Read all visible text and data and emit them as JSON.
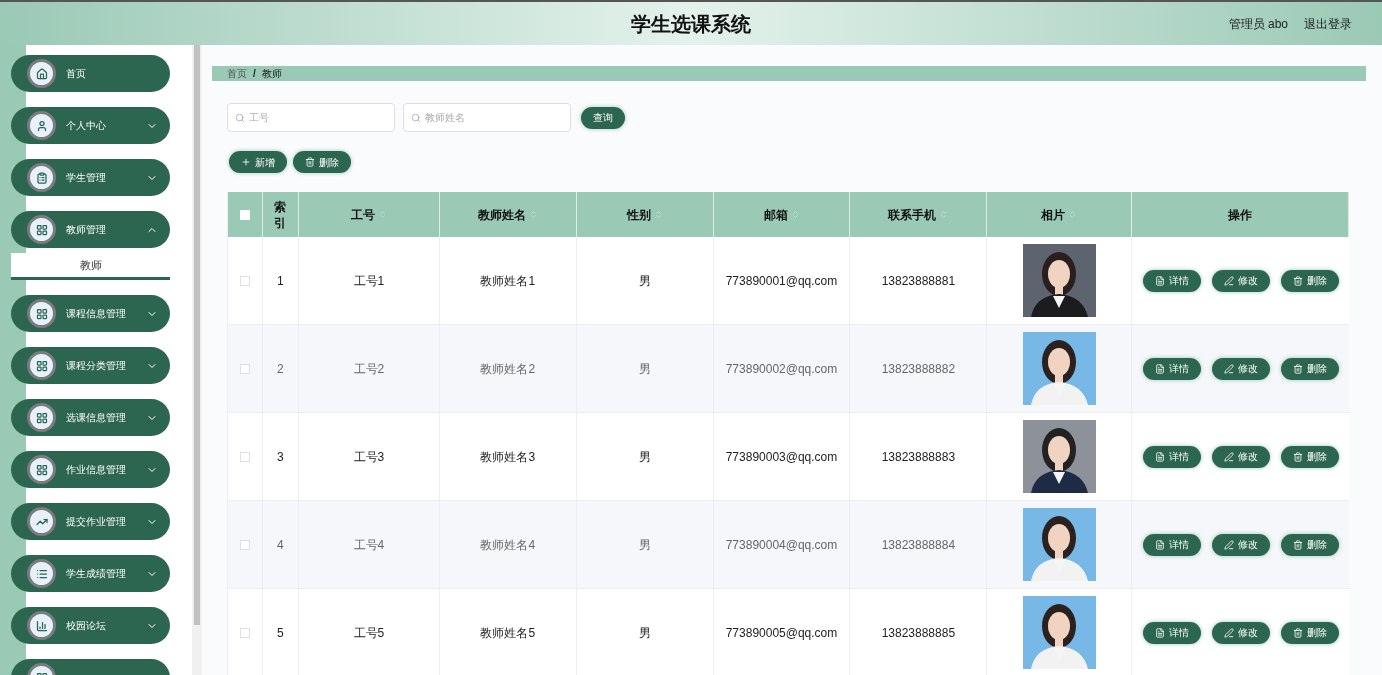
{
  "header": {
    "title": "学生选课系统",
    "user": "管理员 abo",
    "logout": "退出登录"
  },
  "sidebar": {
    "items": [
      {
        "label": "首页",
        "expandable": false
      },
      {
        "label": "个人中心",
        "expandable": true,
        "expanded": false
      },
      {
        "label": "学生管理",
        "expandable": true,
        "expanded": false
      },
      {
        "label": "教师管理",
        "expandable": true,
        "expanded": true,
        "children": [
          {
            "label": "教师",
            "selected": true
          }
        ]
      },
      {
        "label": "课程信息管理",
        "expandable": true,
        "expanded": false
      },
      {
        "label": "课程分类管理",
        "expandable": true,
        "expanded": false
      },
      {
        "label": "选课信息管理",
        "expandable": true,
        "expanded": false
      },
      {
        "label": "作业信息管理",
        "expandable": true,
        "expanded": false
      },
      {
        "label": "提交作业管理",
        "expandable": true,
        "expanded": false
      },
      {
        "label": "学生成绩管理",
        "expandable": true,
        "expanded": false
      },
      {
        "label": "校园论坛",
        "expandable": true,
        "expanded": false
      }
    ]
  },
  "breadcrumb": [
    "首页",
    "教师"
  ],
  "breadcrumb_separator": "/",
  "search": {
    "fields": [
      {
        "placeholder": "工号"
      },
      {
        "placeholder": "教师姓名"
      }
    ],
    "button": "查询"
  },
  "actions": [
    "新增",
    "删除"
  ],
  "table": {
    "select_all": {
      "checked": false
    },
    "columns": [
      {
        "label": "索引",
        "sortable": false
      },
      {
        "label": "工号",
        "sortable": true
      },
      {
        "label": "教师姓名",
        "sortable": true
      },
      {
        "label": "性别",
        "sortable": true
      },
      {
        "label": "邮箱",
        "sortable": true
      },
      {
        "label": "联系手机",
        "sortable": true
      },
      {
        "label": "相片",
        "sortable": true
      },
      {
        "label": "操作",
        "sortable": false
      }
    ],
    "rows": [
      {
        "checked": false,
        "index": "1",
        "id": "工号1",
        "name": "教师姓名1",
        "gender": "男",
        "email": "773890001@qq.com",
        "phone": "13823888881",
        "actions": [
          "详情",
          "修改",
          "删除"
        ]
      },
      {
        "checked": false,
        "index": "2",
        "id": "工号2",
        "name": "教师姓名2",
        "gender": "男",
        "email": "773890002@qq.com",
        "phone": "13823888882",
        "actions": [
          "详情",
          "修改",
          "删除"
        ]
      },
      {
        "checked": false,
        "index": "3",
        "id": "工号3",
        "name": "教师姓名3",
        "gender": "男",
        "email": "773890003@qq.com",
        "phone": "13823888883",
        "actions": [
          "详情",
          "修改",
          "删除"
        ]
      },
      {
        "checked": false,
        "index": "4",
        "id": "工号4",
        "name": "教师姓名4",
        "gender": "男",
        "email": "773890004@qq.com",
        "phone": "13823888884",
        "actions": [
          "详情",
          "修改",
          "删除"
        ]
      },
      {
        "checked": false,
        "index": "5",
        "id": "工号5",
        "name": "教师姓名5",
        "gender": "男",
        "email": "773890005@qq.com",
        "phone": "13823888885",
        "actions": [
          "详情",
          "修改",
          "删除"
        ]
      }
    ]
  }
}
